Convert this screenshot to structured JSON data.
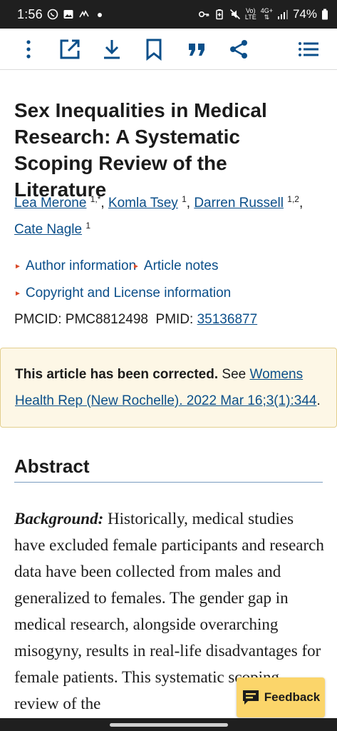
{
  "status_bar": {
    "time": "1:56",
    "battery": "74%",
    "network_top": "Vo)",
    "network_bottom": "LTE",
    "data_top": "4G+",
    "data_bottom": "⇅"
  },
  "toolbar": {
    "icons": [
      "more-vert-icon",
      "open-external-icon",
      "download-icon",
      "bookmark-icon",
      "quote-icon",
      "share-icon",
      "table-of-contents-icon"
    ]
  },
  "article": {
    "title": "Sex Inequalities in Medical Research: A Systematic Scoping Review of the Literature",
    "authors": [
      {
        "name": "Lea Merone",
        "sup": "1,*"
      },
      {
        "name": "Komla Tsey",
        "sup": "1"
      },
      {
        "name": "Darren Russell",
        "sup": "1,2"
      },
      {
        "name": "Cate Nagle",
        "sup": "1"
      }
    ],
    "author_info": "Author information",
    "article_notes": "Article notes",
    "copyright_info": "Copyright and License information",
    "pmcid_label": "PMCID:",
    "pmcid": "PMC8812498",
    "pmid_label": "PMID:",
    "pmid": "35136877"
  },
  "notice": {
    "bold": "This article has been corrected.",
    "see": "See",
    "link": "Womens Health Rep (New Rochelle). 2022 Mar 16;3(1):344",
    "end": "."
  },
  "abstract": {
    "heading": "Abstract",
    "background_label": "Background:",
    "background_text": "Historically, medical studies have excluded female participants and research data have been collected from males and generalized to females. The gender gap in medical research, alongside overarching misogyny, results in real-life disadvantages for female patients. This systematic scoping review of the"
  },
  "feedback": {
    "label": "Feedback"
  },
  "colors": {
    "link": "#0b4f8a",
    "notice_bg": "#fdf7e6",
    "feedback_bg": "#fbd56a"
  }
}
